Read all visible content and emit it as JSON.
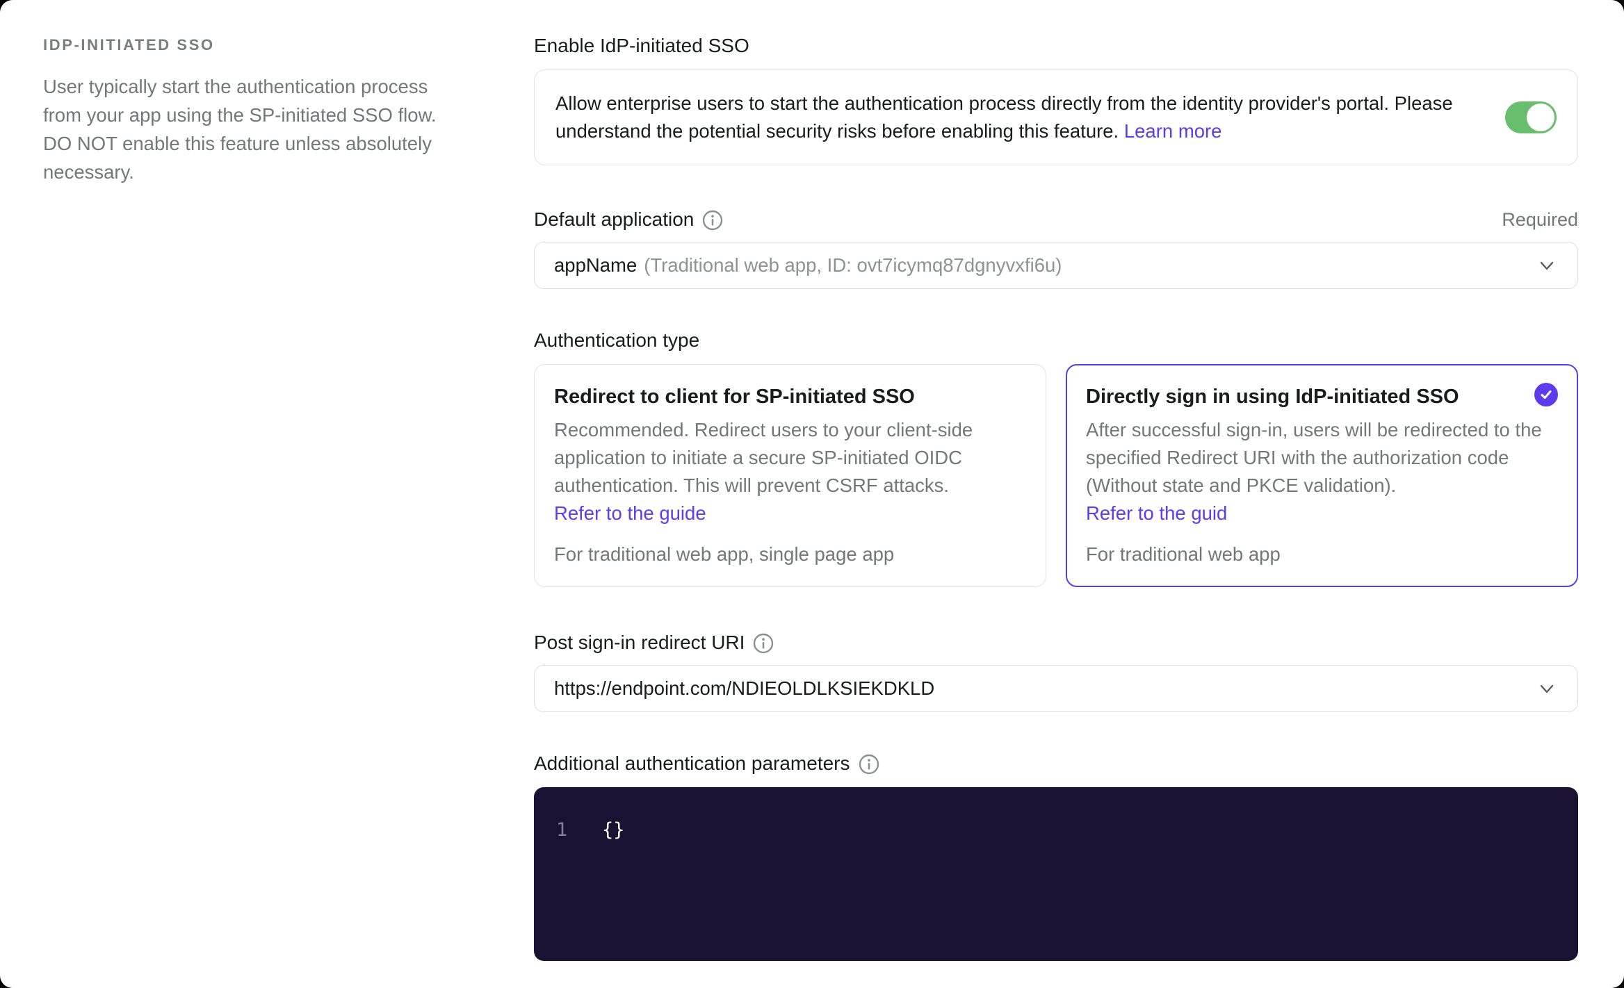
{
  "colors": {
    "brand": "#5d3bee",
    "toggle_on_green": "#68be6d",
    "editor_background": "#1a1133",
    "text_primary": "#191c1d",
    "text_secondary": "#73777a",
    "card_border": "#e0e3e3"
  },
  "icons": {
    "info": "circled-i",
    "chevron_down": "v",
    "check": "checkmark",
    "toggle": "switch-on"
  },
  "aside": {
    "title": "IDP-INITIATED SSO",
    "description": "User typically start the authentication process from your app using the SP-initiated SSO flow. DO NOT enable this feature unless absolutely necessary."
  },
  "enable": {
    "label": "Enable IdP-initiated SSO",
    "description": "Allow enterprise users to start the authentication process directly from the identity provider's portal. Please understand the potential security risks before enabling this feature.",
    "link": "Learn more",
    "toggle_state": "on"
  },
  "default_app": {
    "label": "Default application",
    "required_badge": "Required",
    "value_name": "appName",
    "value_detail": "(Traditional web app, ID: ovt7icymq87dgnyvxfi6u)"
  },
  "auth_type": {
    "label": "Authentication type",
    "options": [
      {
        "title": "Redirect to client for SP-initiated SSO",
        "description": "Recommended. Redirect users to your client-side application to initiate a secure SP-initiated OIDC authentication. This will prevent CSRF attacks.",
        "link": "Refer to the guide",
        "footer": "For traditional web app, single page app",
        "selected": false
      },
      {
        "title": "Directly sign in using IdP-initiated SSO",
        "description": "After successful sign-in, users will be redirected to the specified Redirect URI with the authorization code (Without state and PKCE validation).",
        "link": "Refer to the guid",
        "footer": "For traditional web app",
        "selected": true
      }
    ]
  },
  "redirect_uri": {
    "label": "Post sign-in redirect URI",
    "value": "https://endpoint.com/NDIEOLDLKSIEKDKLD"
  },
  "additional_params": {
    "label": "Additional authentication parameters",
    "line_number": "1",
    "code": "{}"
  }
}
